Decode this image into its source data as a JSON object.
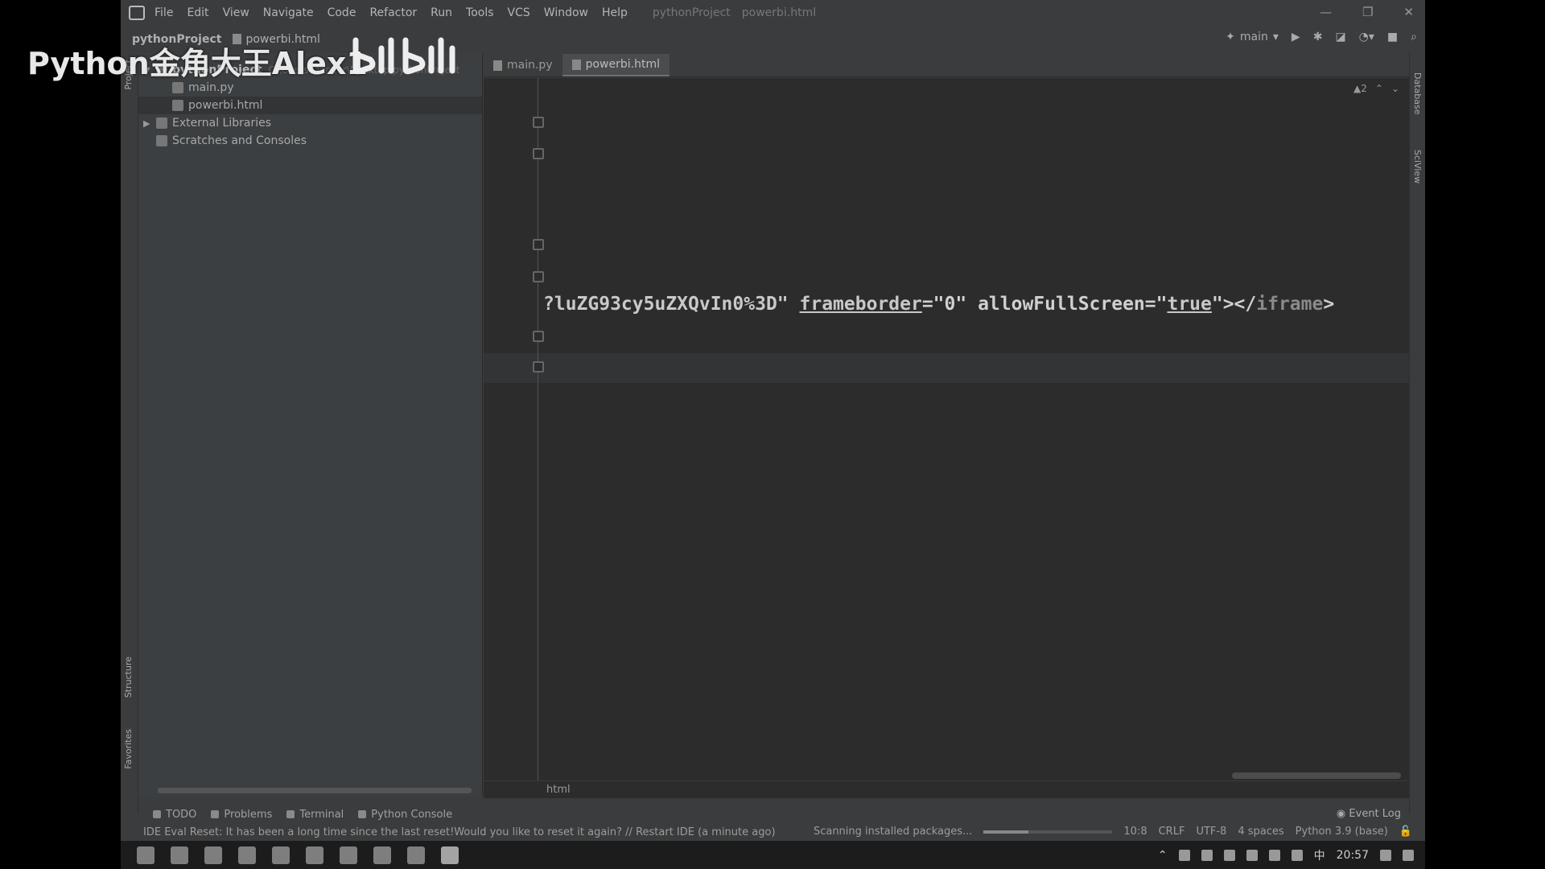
{
  "watermark": {
    "channel": "Python金角大王Alex1",
    "logo_name": "bilibili-logo"
  },
  "menu": {
    "items": [
      "File",
      "Edit",
      "View",
      "Navigate",
      "Code",
      "Refactor",
      "Run",
      "Tools",
      "VCS",
      "Window",
      "Help"
    ],
    "title_project": "pythonProject",
    "title_file": "powerbi.html"
  },
  "nav": {
    "project": "pythonProject",
    "file": "powerbi.html",
    "run_config": "main"
  },
  "project_tree": {
    "root": "pythonProject",
    "root_path": "C:\\Users\\Dancer\\Desktop\\pythonProject",
    "files": [
      "main.py",
      "powerbi.html"
    ],
    "external": "External Libraries",
    "scratches": "Scratches and Consoles"
  },
  "tabs": [
    {
      "label": "main.py",
      "active": false
    },
    {
      "label": "powerbi.html",
      "active": true
    }
  ],
  "editor": {
    "code_prefix": "?luZG93cy5uZXQvIn0%3D\" ",
    "attr1": "frameborder",
    "val1": "=\"0\" allowFullScreen=\"",
    "val2": "true",
    "close": "\"></",
    "tag": "iframe",
    "end": ">",
    "warnings": "▲2",
    "breadcrumb": "html"
  },
  "sidebar": {
    "project_label": "Project",
    "structure_label": "Structure",
    "favorites_label": "Favorites"
  },
  "right_sidebar": {
    "database_label": "Database",
    "sciview_label": "SciView"
  },
  "tool_windows": [
    "TODO",
    "Problems",
    "Terminal",
    "Python Console"
  ],
  "event_log": "Event Log",
  "status": {
    "message": "IDE Eval Reset: It has been a long time since the last reset!Would you like to reset it again? // Restart IDE (a minute ago)",
    "scanning": "Scanning installed packages...",
    "progress": 0.35,
    "position": "10:8",
    "line_sep": "CRLF",
    "encoding": "UTF-8",
    "indent": "4 spaces",
    "interpreter": "Python 3.9 (base)"
  },
  "taskbar": {
    "ime": "中",
    "clock": "20:57"
  }
}
